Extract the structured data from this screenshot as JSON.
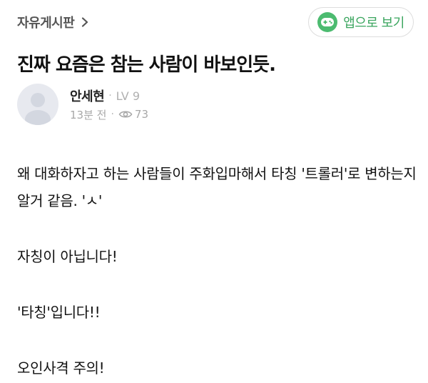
{
  "header": {
    "board_name": "자유게시판",
    "app_button_label": "앱으로 보기",
    "app_button_icon": "gamepad-icon",
    "app_button_color": "#4cbb70"
  },
  "post": {
    "title": "진짜 요즘은 참는 사람이 바보인듯.",
    "author": {
      "name": "안세현",
      "level": "LV 9",
      "avatar_icon": "default-avatar-icon"
    },
    "time": "13분 전",
    "views": "73",
    "views_icon": "eye-icon",
    "body": [
      "왜 대화하자고 하는 사람들이 주화입마해서 타칭 '트롤러'로 변하는지 알거 같음. 'ㅅ'",
      "자칭이 아닙니다!",
      "'타칭'입니다!!",
      "오인사격 주의!"
    ]
  }
}
